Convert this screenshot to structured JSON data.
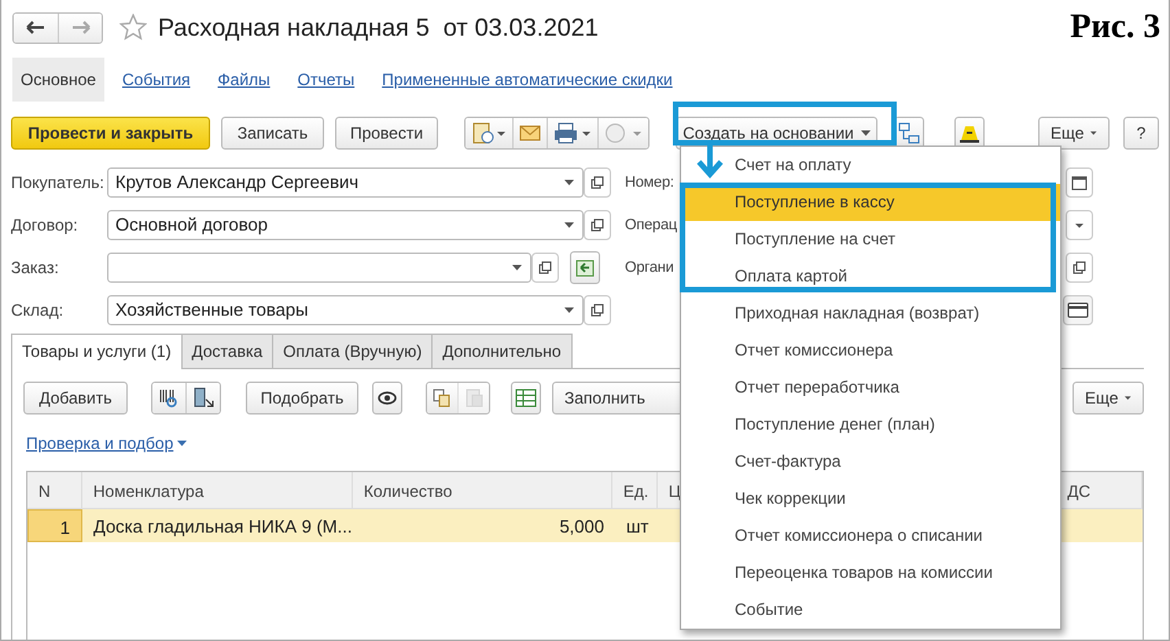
{
  "title": "Расходная накладная 5  от 03.03.2021",
  "figure_label": "Рис. 3",
  "sections": [
    {
      "label": "Основное",
      "selected": true
    },
    {
      "label": "События",
      "selected": false
    },
    {
      "label": "Файлы",
      "selected": false
    },
    {
      "label": "Отчеты",
      "selected": false
    },
    {
      "label": "Примененные автоматические скидки",
      "selected": false
    }
  ],
  "toolbar": {
    "post_close": "Провести и закрыть",
    "save": "Записать",
    "post": "Провести",
    "create_based": "Создать на основании",
    "more": "Еще",
    "help": "?"
  },
  "fields": [
    {
      "label": "Покупатель:",
      "value": "Крутов Александр Сергеевич",
      "kind": "select"
    },
    {
      "label": "Договор:",
      "value": "Основной договор",
      "kind": "select"
    },
    {
      "label": "Заказ:",
      "kind": "order"
    },
    {
      "label": "Склад:",
      "value": "Хозяйственные товары",
      "kind": "select"
    }
  ],
  "right_fields": [
    {
      "label": "Номер:",
      "kind": "date"
    },
    {
      "label": "Операц",
      "kind": "select"
    },
    {
      "label": "Органи",
      "kind": "open"
    },
    {
      "kind": "card"
    }
  ],
  "tabs": [
    {
      "label": "Товары и услуги (1)",
      "selected": true
    },
    {
      "label": "Доставка",
      "selected": false
    },
    {
      "label": "Оплата (Вручную)",
      "selected": false
    },
    {
      "label": "Дополнительно",
      "selected": false
    }
  ],
  "tab_toolbar": {
    "add": "Добавить",
    "pick": "Подобрать",
    "fill": "Заполнить",
    "more": "Еще"
  },
  "check_link": "Проверка и подбор",
  "table": {
    "columns": [
      "N",
      "Номенклатура",
      "Количество",
      "Ед.",
      "Ц",
      "ДС"
    ],
    "rows": [
      {
        "cells": [
          "1",
          "Доска гладильная  НИКА 9 (М...",
          "5,000",
          "шт"
        ],
        "selected": true
      }
    ]
  },
  "menu": {
    "items": [
      {
        "label": "Счет на оплату",
        "selected": false
      },
      {
        "label": "Поступление в кассу",
        "selected": true
      },
      {
        "label": "Поступление на счет",
        "selected": false
      },
      {
        "label": "Оплата картой",
        "selected": false
      },
      {
        "label": "Приходная накладная (возврат)",
        "selected": false
      },
      {
        "label": "Отчет комиссионера",
        "selected": false
      },
      {
        "label": "Отчет переработчика",
        "selected": false
      },
      {
        "label": "Поступление денег (план)",
        "selected": false
      },
      {
        "label": "Счет-фактура",
        "selected": false
      },
      {
        "label": "Чек коррекции",
        "selected": false
      },
      {
        "label": "Отчет комиссионера о списании",
        "selected": false
      },
      {
        "label": "Переоценка товаров на комиссии",
        "selected": false
      },
      {
        "label": "Событие",
        "selected": false
      }
    ]
  }
}
